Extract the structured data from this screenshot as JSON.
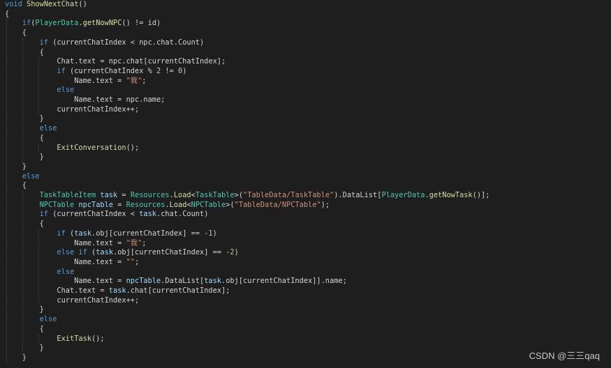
{
  "code": {
    "lines": [
      [
        {
          "t": "void",
          "c": "kw"
        },
        {
          "t": " ",
          "c": "pl"
        },
        {
          "t": "ShowNextChat",
          "c": "fn"
        },
        {
          "t": "()",
          "c": "pl"
        }
      ],
      [
        {
          "t": "{",
          "c": "pl"
        }
      ],
      [
        {
          "t": "    ",
          "c": "pl"
        },
        {
          "t": "if",
          "c": "kw"
        },
        {
          "t": "(",
          "c": "pl"
        },
        {
          "t": "PlayerData",
          "c": "ty"
        },
        {
          "t": ".",
          "c": "pl"
        },
        {
          "t": "getNowNPC",
          "c": "fn"
        },
        {
          "t": "() != id)",
          "c": "pl"
        }
      ],
      [
        {
          "t": "    {",
          "c": "pl"
        }
      ],
      [
        {
          "t": "        ",
          "c": "pl"
        },
        {
          "t": "if",
          "c": "kw"
        },
        {
          "t": " (currentChatIndex < npc.chat.Count)",
          "c": "pl"
        }
      ],
      [
        {
          "t": "        {",
          "c": "pl"
        }
      ],
      [
        {
          "t": "            Chat.text = npc.chat[currentChatIndex];",
          "c": "pl"
        }
      ],
      [
        {
          "t": "            ",
          "c": "pl"
        },
        {
          "t": "if",
          "c": "kw"
        },
        {
          "t": " (currentChatIndex % ",
          "c": "pl"
        },
        {
          "t": "2",
          "c": "num"
        },
        {
          "t": " != ",
          "c": "pl"
        },
        {
          "t": "0",
          "c": "num"
        },
        {
          "t": ")",
          "c": "pl"
        }
      ],
      [
        {
          "t": "                Name.text = ",
          "c": "pl"
        },
        {
          "t": "\"我\"",
          "c": "str"
        },
        {
          "t": ";",
          "c": "pl"
        }
      ],
      [
        {
          "t": "            ",
          "c": "pl"
        },
        {
          "t": "else",
          "c": "kw"
        }
      ],
      [
        {
          "t": "                Name.text = npc.name;",
          "c": "pl"
        }
      ],
      [
        {
          "t": "            currentChatIndex++;",
          "c": "pl"
        }
      ],
      [
        {
          "t": "        }",
          "c": "pl"
        }
      ],
      [
        {
          "t": "        ",
          "c": "pl"
        },
        {
          "t": "else",
          "c": "kw"
        }
      ],
      [
        {
          "t": "        {",
          "c": "pl"
        }
      ],
      [
        {
          "t": "            ",
          "c": "pl"
        },
        {
          "t": "ExitConversation",
          "c": "fn"
        },
        {
          "t": "();",
          "c": "pl"
        }
      ],
      [
        {
          "t": "        }",
          "c": "pl"
        }
      ],
      [
        {
          "t": "    }",
          "c": "pl"
        }
      ],
      [
        {
          "t": "    ",
          "c": "pl"
        },
        {
          "t": "else",
          "c": "kw"
        }
      ],
      [
        {
          "t": "    {",
          "c": "pl"
        }
      ],
      [
        {
          "t": "        ",
          "c": "pl"
        },
        {
          "t": "TaskTableItem",
          "c": "ty"
        },
        {
          "t": " ",
          "c": "pl"
        },
        {
          "t": "task",
          "c": "var"
        },
        {
          "t": " = ",
          "c": "pl"
        },
        {
          "t": "Resources",
          "c": "ty"
        },
        {
          "t": ".",
          "c": "pl"
        },
        {
          "t": "Load",
          "c": "fn"
        },
        {
          "t": "<",
          "c": "pl"
        },
        {
          "t": "TaskTable",
          "c": "ty"
        },
        {
          "t": ">(",
          "c": "pl"
        },
        {
          "t": "\"TableData/TaskTable\"",
          "c": "str"
        },
        {
          "t": ").DataList[",
          "c": "pl"
        },
        {
          "t": "PlayerData",
          "c": "ty"
        },
        {
          "t": ".",
          "c": "pl"
        },
        {
          "t": "getNowTask",
          "c": "fn"
        },
        {
          "t": "()];",
          "c": "pl"
        }
      ],
      [
        {
          "t": "        ",
          "c": "pl"
        },
        {
          "t": "NPCTable",
          "c": "ty"
        },
        {
          "t": " ",
          "c": "pl"
        },
        {
          "t": "npcTable",
          "c": "var"
        },
        {
          "t": " = ",
          "c": "pl"
        },
        {
          "t": "Resources",
          "c": "ty"
        },
        {
          "t": ".",
          "c": "pl"
        },
        {
          "t": "Load",
          "c": "fn"
        },
        {
          "t": "<",
          "c": "pl"
        },
        {
          "t": "NPCTable",
          "c": "ty"
        },
        {
          "t": ">(",
          "c": "pl"
        },
        {
          "t": "\"TableData/NPCTable\"",
          "c": "str"
        },
        {
          "t": ");",
          "c": "pl"
        }
      ],
      [
        {
          "t": "        ",
          "c": "pl"
        },
        {
          "t": "if",
          "c": "kw"
        },
        {
          "t": " (currentChatIndex < ",
          "c": "pl"
        },
        {
          "t": "task",
          "c": "var"
        },
        {
          "t": ".chat.Count)",
          "c": "pl"
        }
      ],
      [
        {
          "t": "        {",
          "c": "pl"
        }
      ],
      [
        {
          "t": "            ",
          "c": "pl"
        },
        {
          "t": "if",
          "c": "kw"
        },
        {
          "t": " (",
          "c": "pl"
        },
        {
          "t": "task",
          "c": "var"
        },
        {
          "t": ".obj[currentChatIndex] == -",
          "c": "pl"
        },
        {
          "t": "1",
          "c": "num"
        },
        {
          "t": ")",
          "c": "pl"
        }
      ],
      [
        {
          "t": "                Name.text = ",
          "c": "pl"
        },
        {
          "t": "\"我\"",
          "c": "str"
        },
        {
          "t": ";",
          "c": "pl"
        }
      ],
      [
        {
          "t": "            ",
          "c": "pl"
        },
        {
          "t": "else if",
          "c": "kw"
        },
        {
          "t": " (",
          "c": "pl"
        },
        {
          "t": "task",
          "c": "var"
        },
        {
          "t": ".obj[currentChatIndex] == -",
          "c": "pl"
        },
        {
          "t": "2",
          "c": "num"
        },
        {
          "t": ")",
          "c": "pl"
        }
      ],
      [
        {
          "t": "                Name.text = ",
          "c": "pl"
        },
        {
          "t": "\"\"",
          "c": "str"
        },
        {
          "t": ";",
          "c": "pl"
        }
      ],
      [
        {
          "t": "            ",
          "c": "pl"
        },
        {
          "t": "else",
          "c": "kw"
        }
      ],
      [
        {
          "t": "                Name.text = ",
          "c": "pl"
        },
        {
          "t": "npcTable",
          "c": "var"
        },
        {
          "t": ".DataList[",
          "c": "pl"
        },
        {
          "t": "task",
          "c": "var"
        },
        {
          "t": ".obj[currentChatIndex]].name;",
          "c": "pl"
        }
      ],
      [
        {
          "t": "            Chat.text = ",
          "c": "pl"
        },
        {
          "t": "task",
          "c": "var"
        },
        {
          "t": ".chat[currentChatIndex];",
          "c": "pl"
        }
      ],
      [
        {
          "t": "            currentChatIndex++;",
          "c": "pl"
        }
      ],
      [
        {
          "t": "        }",
          "c": "pl"
        }
      ],
      [
        {
          "t": "        ",
          "c": "pl"
        },
        {
          "t": "else",
          "c": "kw"
        }
      ],
      [
        {
          "t": "        {",
          "c": "pl"
        }
      ],
      [
        {
          "t": "            ",
          "c": "pl"
        },
        {
          "t": "ExitTask",
          "c": "fn"
        },
        {
          "t": "();",
          "c": "pl"
        }
      ],
      [
        {
          "t": "        }",
          "c": "pl"
        }
      ],
      [
        {
          "t": "    }",
          "c": "pl"
        }
      ]
    ]
  },
  "watermark": {
    "text": "CSDN @三三qaq"
  },
  "colors": {
    "background": "#1e1e1e",
    "keyword": "#569cd6",
    "function": "#dcdcaa",
    "type": "#4ec9b0",
    "variable": "#9cdcfe",
    "string": "#ce9178",
    "number": "#b5cea8",
    "plain": "#d4d4d4"
  }
}
